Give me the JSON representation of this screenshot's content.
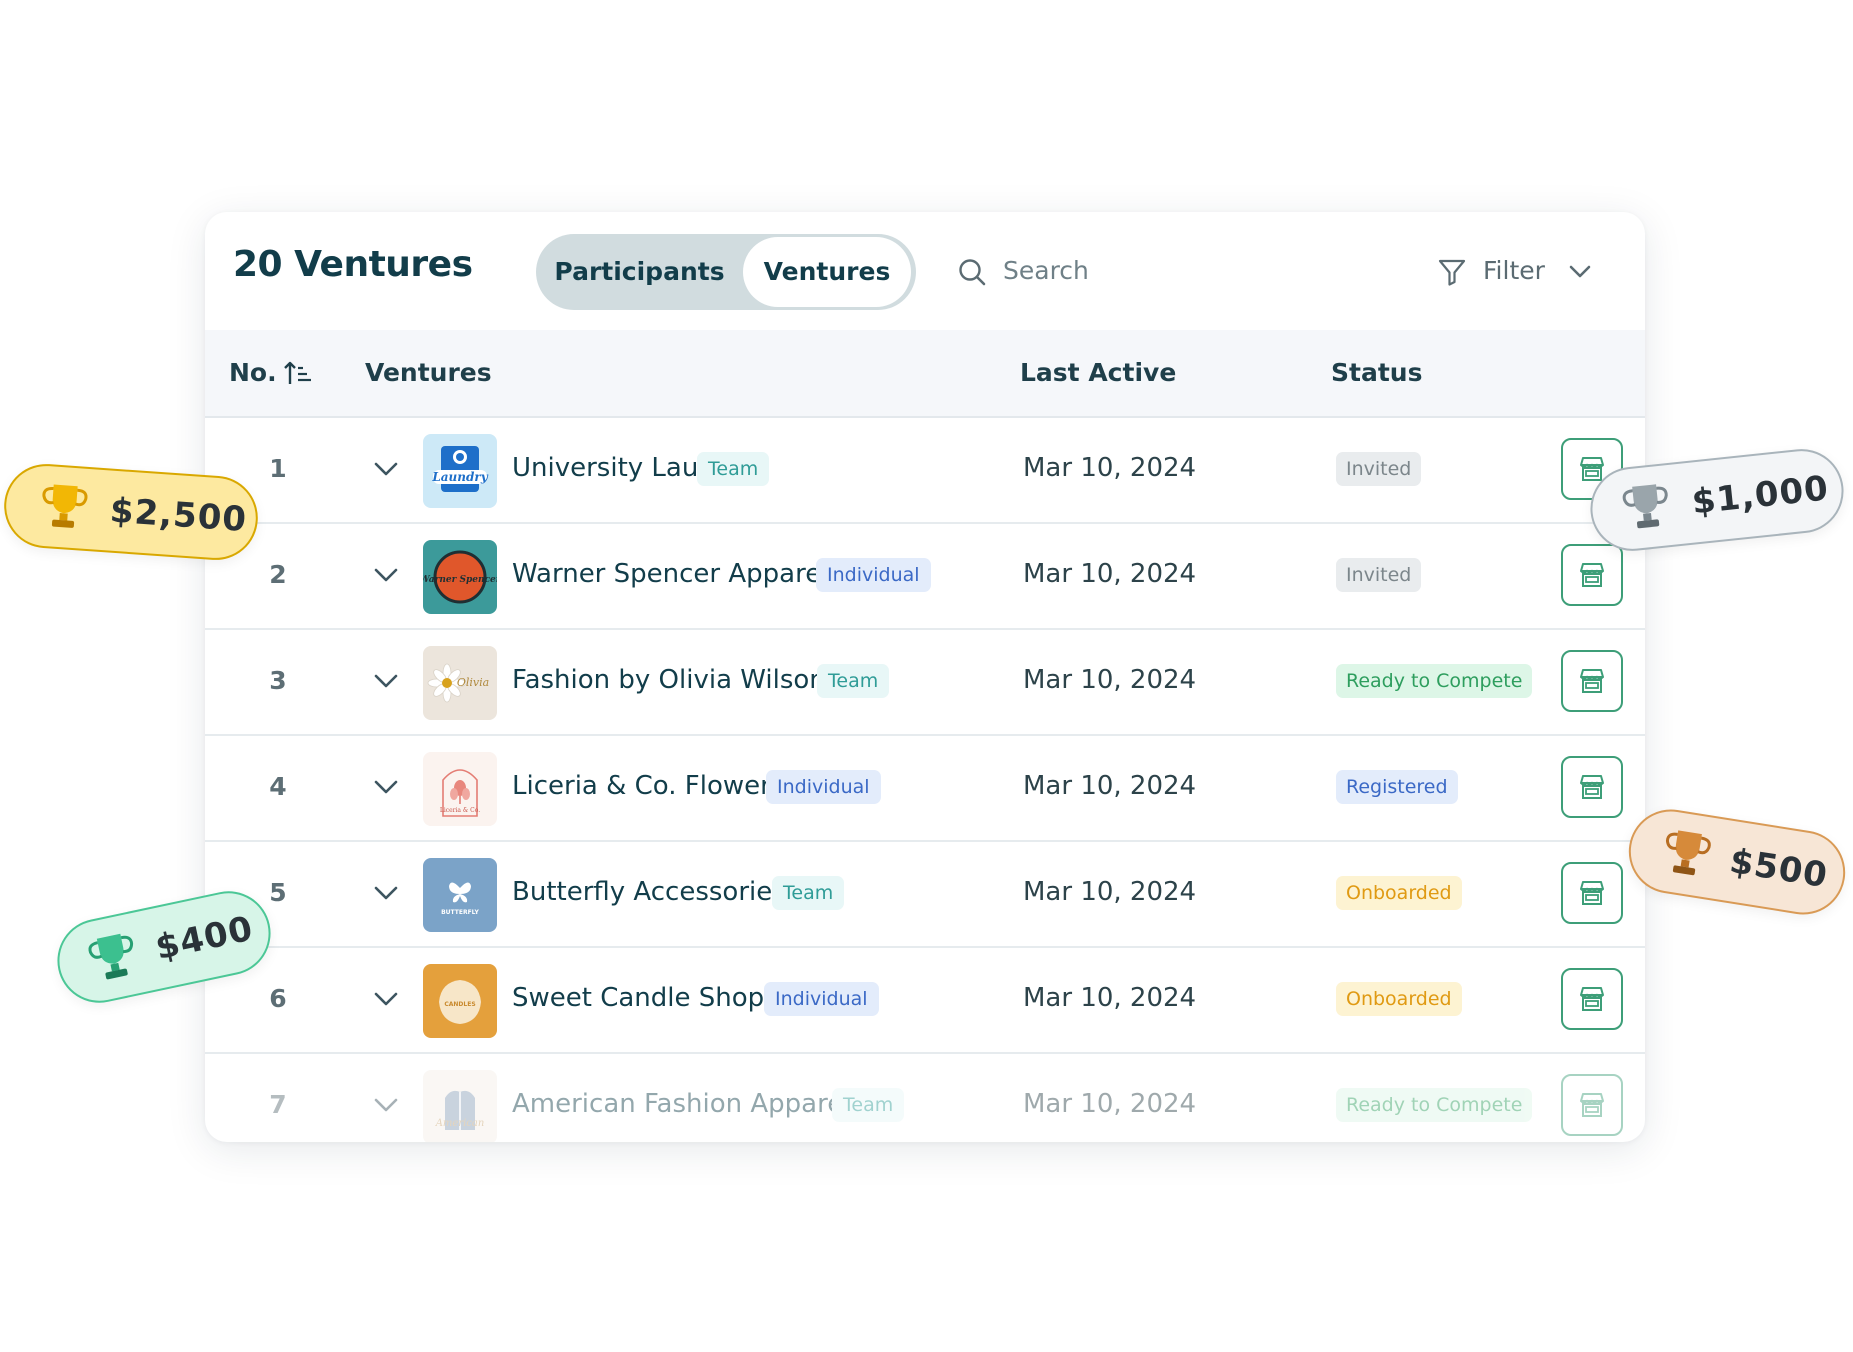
{
  "header": {
    "title": "20 Ventures",
    "tabs": [
      {
        "label": "Participants"
      },
      {
        "label": "Ventures",
        "active": true
      }
    ],
    "search_placeholder": "Search",
    "filter_label": "Filter"
  },
  "table": {
    "columns": [
      "No.",
      "Ventures",
      "Last Active",
      "Status"
    ],
    "rows": [
      {
        "no": "1",
        "name": "University Laundry",
        "tag": "Team",
        "last_active": "Mar 10, 2024",
        "status": "Invited"
      },
      {
        "no": "2",
        "name": "Warner Spencer Apparel",
        "tag": "Individual",
        "last_active": "Mar 10, 2024",
        "status": "Invited"
      },
      {
        "no": "3",
        "name": "Fashion by Olivia Wilson",
        "tag": "Team",
        "last_active": "Mar 10, 2024",
        "status": "Ready to Compete"
      },
      {
        "no": "4",
        "name": "Liceria & Co. Flower",
        "tag": "Individual",
        "last_active": "Mar 10, 2024",
        "status": "Registered"
      },
      {
        "no": "5",
        "name": "Butterfly Accessories",
        "tag": "Team",
        "last_active": "Mar 10, 2024",
        "status": "Onboarded"
      },
      {
        "no": "6",
        "name": "Sweet Candle Shop",
        "tag": "Individual",
        "last_active": "Mar 10, 2024",
        "status": "Onboarded"
      },
      {
        "no": "7",
        "name": "American Fashion Apparel",
        "tag": "Team",
        "last_active": "Mar 10, 2024",
        "status": "Ready to Compete"
      }
    ]
  },
  "logos": {
    "laundry": "Laundry",
    "warner": "Warner Spencer",
    "olivia": "Olivia",
    "liceria": "Liceria & Co.",
    "butterfly": "BUTTERFLY",
    "candles": "CANDLES",
    "american": "American"
  },
  "prizes": [
    {
      "amount": "$2,500",
      "color": "#f2b705"
    },
    {
      "amount": "$1,000",
      "color": "#9aa5ab"
    },
    {
      "amount": "$500",
      "color": "#d68a3a"
    },
    {
      "amount": "$400",
      "color": "#3cc08f"
    }
  ],
  "colors": {
    "primary_text": "#123d4a",
    "accent_green": "#3d9e78",
    "segment_bg": "#d1dcdf"
  }
}
